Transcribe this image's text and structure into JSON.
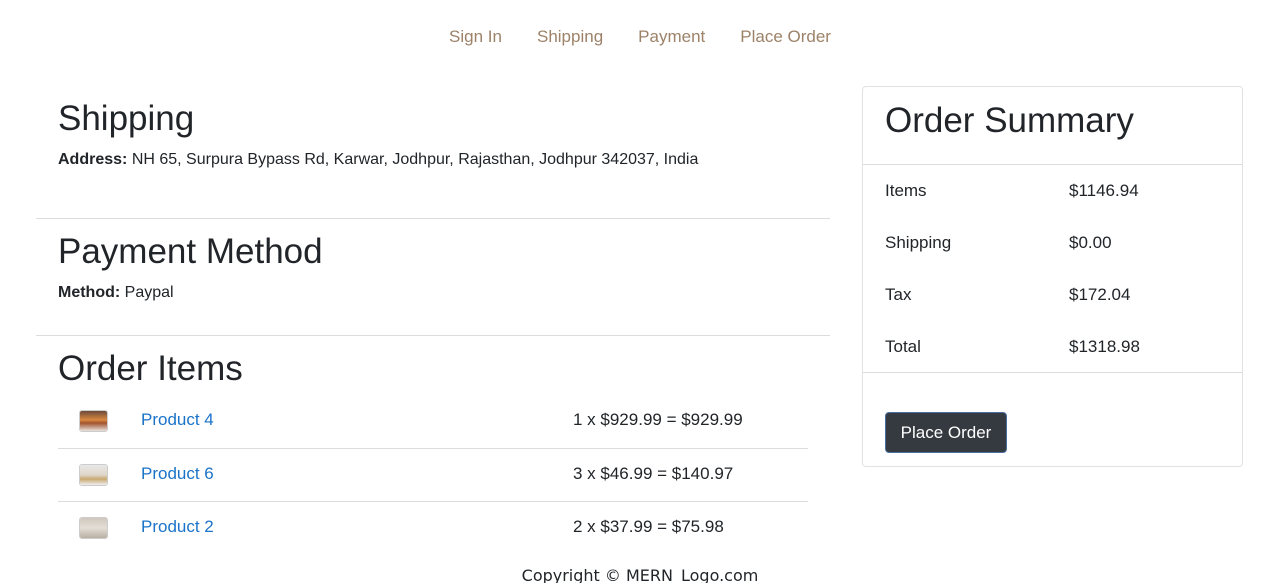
{
  "steps": [
    "Sign In",
    "Shipping",
    "Payment",
    "Place Order"
  ],
  "shipping": {
    "title": "Shipping",
    "address_label": "Address:",
    "address": "NH 65, Surpura Bypass Rd, Karwar, Jodhpur, Rajasthan, Jodhpur 342037, India"
  },
  "payment": {
    "title": "Payment Method",
    "method_label": "Method:",
    "method": "Paypal"
  },
  "order_items": {
    "title": "Order Items",
    "items": [
      {
        "name": "Product 4",
        "calc": "1 x $929.99 = $929.99"
      },
      {
        "name": "Product 6",
        "calc": "3 x $46.99 = $140.97"
      },
      {
        "name": "Product 2",
        "calc": "2 x $37.99 = $75.98"
      }
    ]
  },
  "summary": {
    "title": "Order Summary",
    "rows": [
      {
        "label": "Items",
        "value": "$1146.94"
      },
      {
        "label": "Shipping",
        "value": "$0.00"
      },
      {
        "label": "Tax",
        "value": "$172.04"
      },
      {
        "label": "Total",
        "value": "$1318.98"
      }
    ],
    "button": "Place Order"
  },
  "footer": "Copyright © MERN_Logo.com"
}
